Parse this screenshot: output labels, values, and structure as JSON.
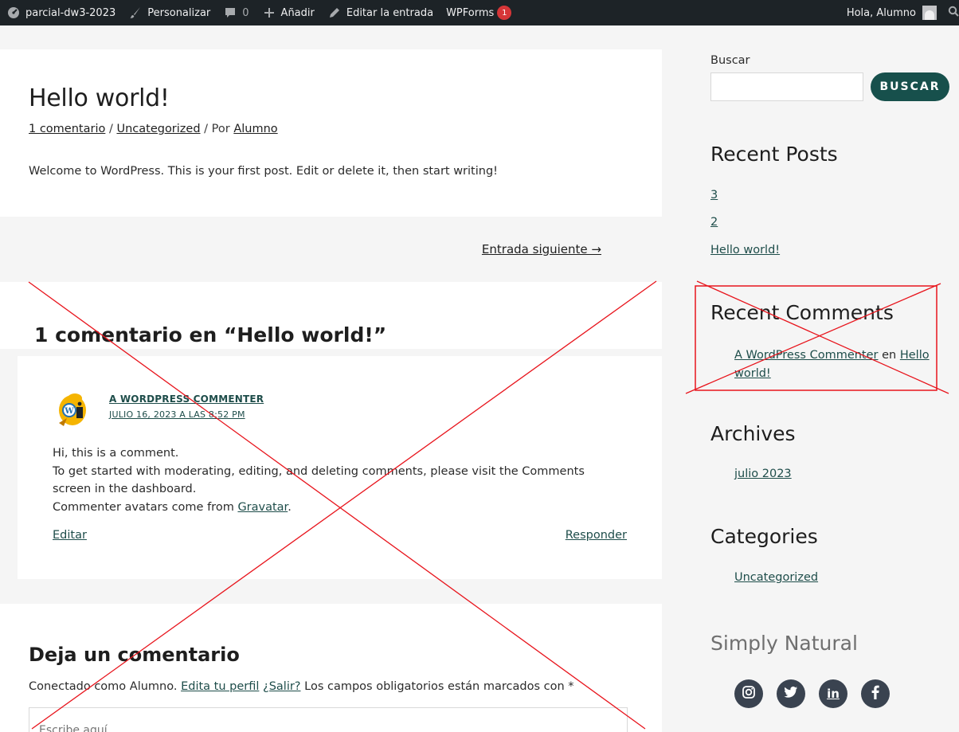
{
  "adminbar": {
    "site_name": "parcial-dw3-2023",
    "customize": "Personalizar",
    "comments_count": "0",
    "add": "Añadir",
    "edit_post": "Editar la entrada",
    "wpforms": "WPForms",
    "wpforms_badge": "1",
    "greeting": "Hola, Alumno"
  },
  "post": {
    "title": "Hello world!",
    "meta_comments": "1 comentario",
    "meta_sep1": " / ",
    "meta_category": "Uncategorized",
    "meta_sep2": " / Por ",
    "meta_author": "Alumno",
    "body": "Welcome to WordPress. This is your first post. Edit or delete it, then start writing!"
  },
  "nav": {
    "next": "Entrada siguiente →"
  },
  "comments": {
    "title": "1 comentario en “Hello world!”",
    "items": [
      {
        "author": "A WORDPRESS COMMENTER",
        "date": "JULIO 16, 2023 A LAS 8:52 PM",
        "line1": "Hi, this is a comment.",
        "line2": "To get started with moderating, editing, and deleting comments, please visit the Comments screen in the dashboard.",
        "line3_prefix": "Commenter avatars come from ",
        "line3_link": "Gravatar",
        "line3_suffix": ".",
        "edit": "Editar",
        "reply": "Responder"
      }
    ]
  },
  "reply_form": {
    "title": "Deja un comentario",
    "logged_prefix": "Conectado como Alumno. ",
    "edit_profile": "Edita tu perfil",
    "logout": "¿Salir?",
    "required_note": " Los campos obligatorios están marcados con *",
    "placeholder": "Escribe aquí..."
  },
  "sidebar": {
    "search_label": "Buscar",
    "search_button": "BUSCAR",
    "recent_posts_title": "Recent Posts",
    "recent_posts": [
      "3",
      "2",
      "Hello world!"
    ],
    "recent_comments_title": "Recent Comments",
    "recent_comment_author": "A WordPress Commenter",
    "recent_comment_on": " en ",
    "recent_comment_post_a": "Hello",
    "recent_comment_post_b": "world!",
    "archives_title": "Archives",
    "archives": [
      "julio 2023"
    ],
    "categories_title": "Categories",
    "categories": [
      "Uncategorized"
    ],
    "brand": "Simply Natural"
  },
  "social_icons": [
    "instagram-icon",
    "twitter-icon",
    "linkedin-icon",
    "facebook-icon"
  ],
  "colors": {
    "accent": "#17504c",
    "link": "#1e4d4a",
    "adminbar": "#1d2327",
    "overlay_red": "#e8141c"
  }
}
